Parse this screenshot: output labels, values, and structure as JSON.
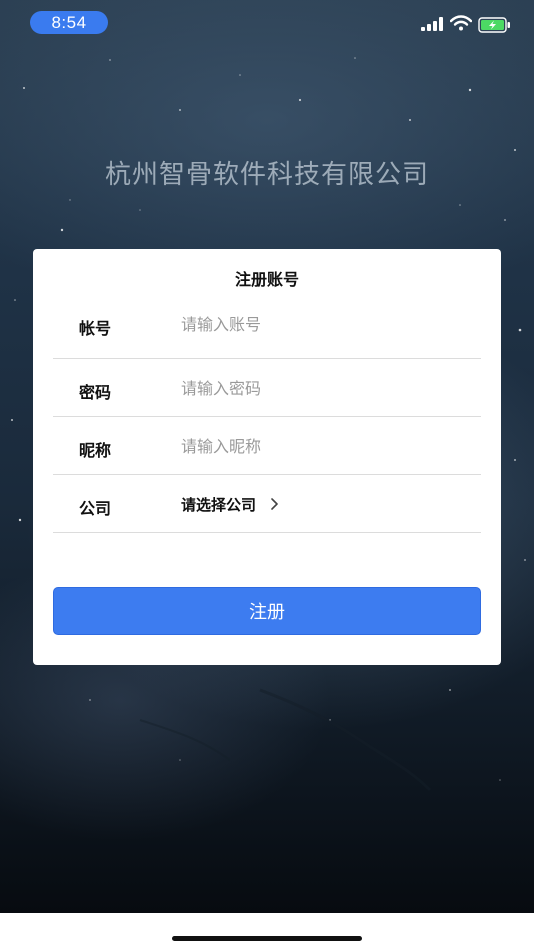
{
  "status_bar": {
    "time": "8:54",
    "icons": [
      "signal-icon",
      "wifi-icon",
      "battery-charging-icon"
    ]
  },
  "header": {
    "company_name": "杭州智骨软件科技有限公司"
  },
  "form": {
    "title": "注册账号",
    "account": {
      "label": "帐号",
      "placeholder": "请输入账号",
      "value": ""
    },
    "password": {
      "label": "密码",
      "placeholder": "请输入密码",
      "value": ""
    },
    "nickname": {
      "label": "昵称",
      "placeholder": "请输入昵称",
      "value": ""
    },
    "company": {
      "label": "公司",
      "select_text": "请选择公司"
    },
    "submit_label": "注册"
  },
  "colors": {
    "accent": "#3d7cf0",
    "time_pill": "#3a7bef",
    "battery": "#4cd964"
  }
}
